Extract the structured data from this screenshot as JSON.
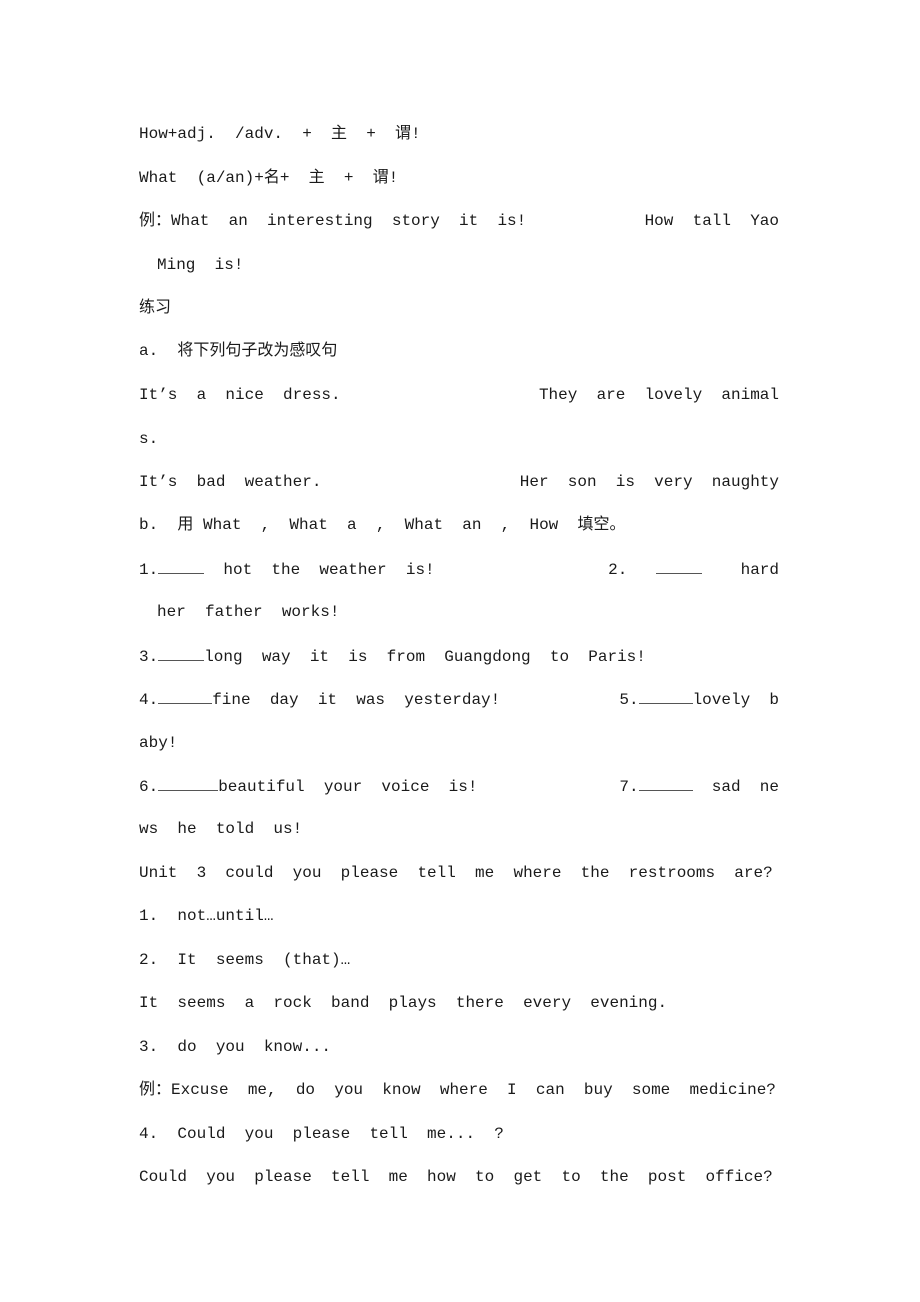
{
  "lines": {
    "l1": "How+adj.  /adv.  +  主  +  谓!",
    "l2": "What  (a/an)+名+  主  +  谓!",
    "l3_left": "例：What  an  interesting  story  it  is!",
    "l3_right": "How  tall  Yao",
    "l4": "Ming  is!",
    "l5": "练习",
    "l6": "a.  将下列句子改为感叹句",
    "l7_left": "It’s  a  nice  dress.",
    "l7_right": "They  are  lovely  animal",
    "l8": "s.",
    "l9_left": "It’s  bad  weather.",
    "l9_right": "Her  son  is  very  naughty",
    "l10": "b.  用 What  ,  What  a  ,  What  an  ,  How  填空。",
    "q1_num": "1.",
    "q1_text": "  hot  the  weather  is!",
    "q2_num": "2.",
    "q2_text": "hard",
    "q2_cont": "her  father  works!",
    "q3_num": "3.",
    "q3_text": "long  way  it  is  from  Guangdong  to  Paris!",
    "q4_num": "4.",
    "q4_text": "fine  day  it  was  yesterday!",
    "q5_num": "5.",
    "q5_text": "lovely  b",
    "q5_cont": "aby!",
    "q6_num": "6.",
    "q6_text": "beautiful  your  voice  is!",
    "q7_num": "7.",
    "q7_text": "  sad  ne",
    "q7_cont": "ws  he  told  us!",
    "unit3_title": "Unit  3  could  you  please  tell  me  where  the  restrooms  are?",
    "u1": "1.  not…until…",
    "u2": "2.  It  seems  (that)…",
    "u2_ex": "It  seems  a  rock  band  plays  there  every  evening.",
    "u3": "3.  do  you  know...",
    "u3_ex": "例：Excuse  me,  do  you  know  where  I  can  buy  some  medicine?",
    "u4": "4.  Could  you  please  tell  me...  ?",
    "u4_ex": "Could  you  please  tell  me  how  to  get  to  the  post  office?"
  }
}
